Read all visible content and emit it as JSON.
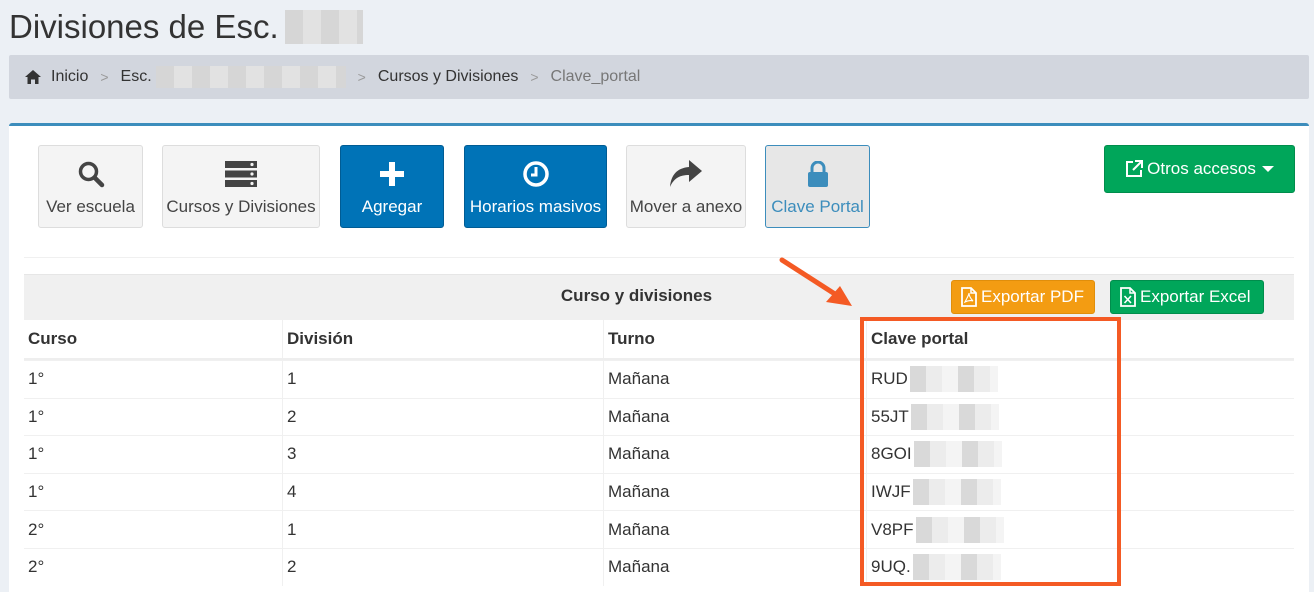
{
  "page": {
    "title": "Divisiones de Esc."
  },
  "breadcrumb": {
    "home": "Inicio",
    "school": "Esc.",
    "courses": "Cursos y Divisiones",
    "current": "Clave_portal",
    "separator": ">"
  },
  "toolbar": {
    "ver_escuela": "Ver escuela",
    "cursos_divisiones": "Cursos y Divisiones",
    "agregar": "Agregar",
    "horarios_masivos": "Horarios masivos",
    "mover_anexo": "Mover a anexo",
    "clave_portal": "Clave Portal",
    "otros_accesos": "Otros accesos"
  },
  "table": {
    "caption": "Curso y divisiones",
    "export_pdf": "Exportar PDF",
    "export_excel": "Exportar Excel",
    "headers": [
      "Curso",
      "División",
      "Turno",
      "Clave portal"
    ],
    "rows": [
      [
        "1°",
        "1",
        "Mañana",
        "RUD"
      ],
      [
        "1°",
        "2",
        "Mañana",
        "55JT"
      ],
      [
        "1°",
        "3",
        "Mañana",
        "8GOI"
      ],
      [
        "1°",
        "4",
        "Mañana",
        "IWJF"
      ],
      [
        "2°",
        "1",
        "Mañana",
        "V8PF"
      ],
      [
        "2°",
        "2",
        "Mañana",
        "9UQ."
      ]
    ]
  },
  "colors": {
    "primary": "#0073b7",
    "success": "#00a65a",
    "warning": "#f39c12",
    "box_border": "#3c8dbc",
    "highlight": "#f45a24"
  },
  "icons": {
    "home": "home-icon",
    "ver_escuela": "search-icon",
    "cursos_divisiones": "server-list-icon",
    "agregar": "plus-icon",
    "horarios_masivos": "clock-icon",
    "mover_anexo": "share-arrow-icon",
    "clave_portal": "lock-icon",
    "otros_accesos": "external-link-icon",
    "export_pdf": "file-pdf-icon",
    "export_excel": "file-excel-icon"
  }
}
